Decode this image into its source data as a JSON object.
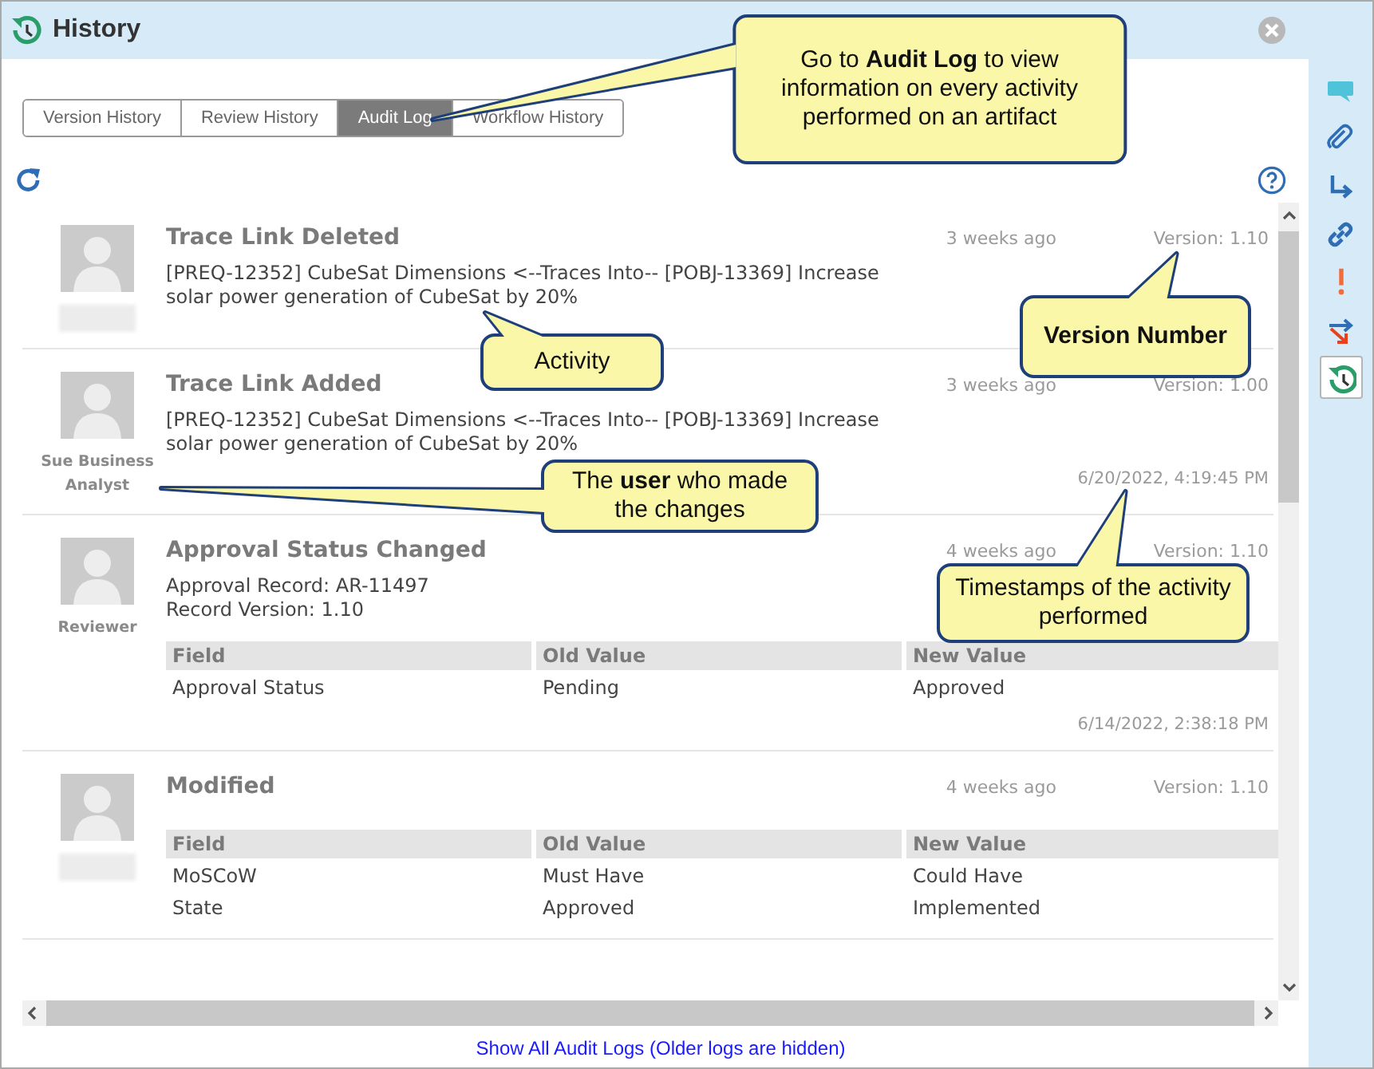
{
  "window": {
    "title": "History"
  },
  "tabs": [
    {
      "label": "Version History",
      "selected": false
    },
    {
      "label": "Review History",
      "selected": false
    },
    {
      "label": "Audit Log",
      "selected": true
    },
    {
      "label": "Workflow History",
      "selected": false
    }
  ],
  "entries": [
    {
      "user_hidden": true,
      "title": "Trace Link Deleted",
      "time_ago": "3 weeks ago",
      "version": "Version: 1.10",
      "description": [
        "[PREQ-12352] CubeSat Dimensions <--Traces Into-- [POBJ-13369] Increase solar power generation of CubeSat by 20%"
      ]
    },
    {
      "user": "Sue Business Analyst",
      "title": "Trace Link Added",
      "time_ago": "3 weeks ago",
      "version": "Version: 1.00",
      "description": [
        "[PREQ-12352] CubeSat Dimensions <--Traces Into-- [POBJ-13369] Increase solar power generation of CubeSat by 20%"
      ],
      "timestamp": "6/20/2022, 4:19:45 PM"
    },
    {
      "user": "Reviewer",
      "title": "Approval Status Changed",
      "time_ago": "4 weeks ago",
      "version": "Version: 1.10",
      "description": [
        "Approval Record: AR-11497",
        "Record Version: 1.10"
      ],
      "table": {
        "columns": [
          "Field",
          "Old Value",
          "New Value"
        ],
        "rows": [
          [
            "Approval Status",
            "Pending",
            "Approved"
          ]
        ]
      },
      "timestamp": "6/14/2022, 2:38:18 PM"
    },
    {
      "user_hidden": true,
      "title": "Modified",
      "time_ago": "4 weeks ago",
      "version": "Version: 1.10",
      "table": {
        "columns": [
          "Field",
          "Old Value",
          "New Value"
        ],
        "rows": [
          [
            "MoSCoW",
            "Must Have",
            "Could Have"
          ],
          [
            "State",
            "Approved",
            "Implemented"
          ]
        ]
      }
    }
  ],
  "footer_link": "Show All Audit Logs (Older logs are hidden)",
  "sidebar": [
    {
      "kind": "comment",
      "selected": false
    },
    {
      "kind": "attachment",
      "selected": false
    },
    {
      "kind": "turn",
      "selected": false
    },
    {
      "kind": "link",
      "selected": false
    },
    {
      "kind": "alert",
      "selected": false
    },
    {
      "kind": "branch",
      "selected": false
    },
    {
      "kind": "history",
      "selected": true
    }
  ],
  "callouts": [
    {
      "text": "Go to **Audit Log** to view information on every activity performed on an artifact",
      "bold": false
    },
    {
      "text": "Version Number",
      "bold": true
    },
    {
      "text": "Activity",
      "bold": false
    },
    {
      "text": "The **user** who made the changes",
      "bold": false
    },
    {
      "text": "Timestamps of the activity performed",
      "bold": false
    }
  ]
}
